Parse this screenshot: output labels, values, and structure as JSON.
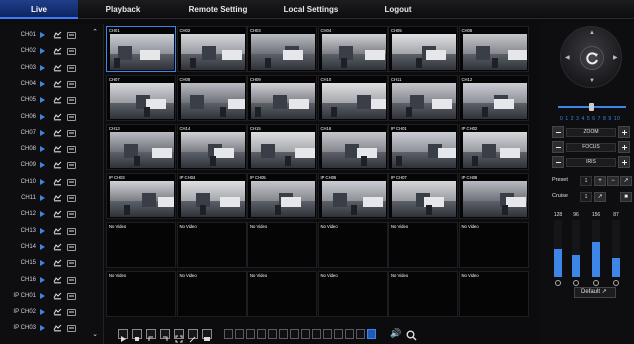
{
  "nav": {
    "live": "Live",
    "playback": "Playback",
    "remote_setting": "Remote Setting",
    "local_settings": "Local Settings",
    "logout": "Logout"
  },
  "channels": [
    "CH01",
    "CH02",
    "CH03",
    "CH04",
    "CH05",
    "CH06",
    "CH07",
    "CH08",
    "CH09",
    "CH10",
    "CH11",
    "CH12",
    "CH13",
    "CH14",
    "CH15",
    "CH16",
    "IP CH01",
    "IP CH02",
    "IP CH03"
  ],
  "grid": {
    "cells": [
      "CH01",
      "CH02",
      "CH03",
      "CH04",
      "CH05",
      "CH06",
      "CH07",
      "CH08",
      "CH09",
      "CH10",
      "CH11",
      "CH12",
      "CH13",
      "CH14",
      "CH15",
      "CH16",
      "IP CH01",
      "IP CH02",
      "IP CH03",
      "IP CH04",
      "IP CH05",
      "IP CH06",
      "IP CH07",
      "IP CH08",
      "No Video",
      "No Video",
      "No Video",
      "No Video",
      "No Video",
      "No Video",
      "No Video",
      "No Video",
      "No Video",
      "No Video",
      "No Video",
      "No Video"
    ],
    "selected_index": 0
  },
  "ptz": {
    "speed_numbers": "0 1 2 3 4 5 6 7 8 9 10",
    "speed_value": 0.45,
    "zoom": "ZOOM",
    "focus": "FOCUS",
    "iris": "IRIS",
    "preset_label": "Preset",
    "preset_value": "1",
    "cruise_label": "Cruise",
    "cruise_value": "1"
  },
  "image": {
    "values": [
      "128",
      "96",
      "156",
      "87"
    ],
    "levels": [
      0.5,
      0.38,
      0.61,
      0.34
    ],
    "default_label": "Default"
  },
  "colors": {
    "accent": "#3d86e8",
    "background": "#0c0c0f"
  }
}
